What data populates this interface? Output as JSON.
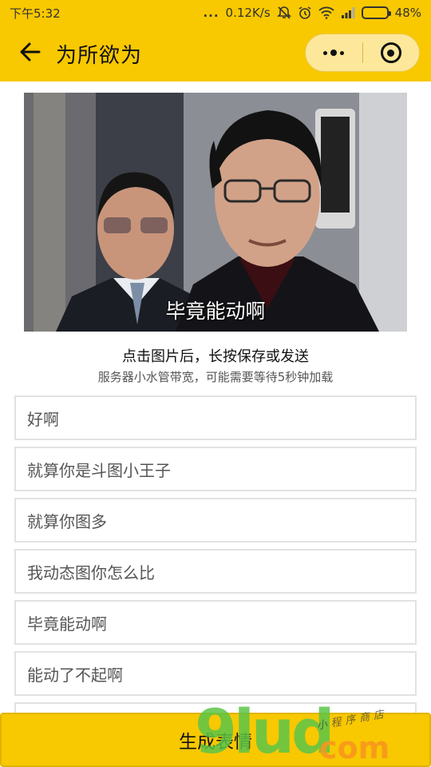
{
  "status_bar": {
    "time": "下午5:32",
    "more": "...",
    "network_speed": "0.12K/s",
    "battery_percent": "48%",
    "battery_level": 0.48
  },
  "nav": {
    "title": "为所欲为",
    "back_icon": "arrow-left-icon",
    "menu_icon": "more-dots-icon",
    "close_icon": "target-circle-icon"
  },
  "meme": {
    "caption": "毕竟能动啊"
  },
  "hints": {
    "main": "点击图片后，长按保存或发送",
    "sub": "服务器小水管带宽，可能需要等待5秒钟加载"
  },
  "fields": [
    "好啊",
    "就算你是斗图小王子",
    "就算你图多",
    "我动态图你怎么比",
    "毕竟能动啊",
    "能动了不起啊",
    ""
  ],
  "generate_label": "生成表情",
  "watermark": {
    "logo": "9lud",
    "domain": "com",
    "stamp": "小程序商店"
  },
  "colors": {
    "brand_yellow": "#f8c800",
    "watermark_green": "#5cc448",
    "watermark_orange": "#f7961e"
  }
}
